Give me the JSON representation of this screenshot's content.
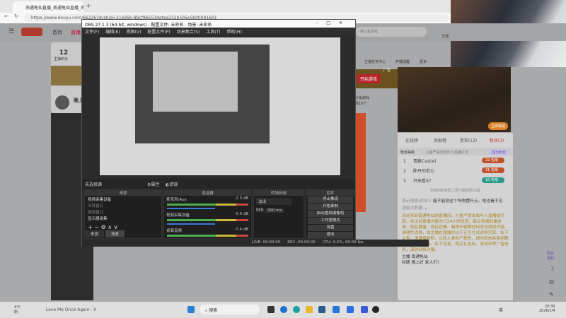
{
  "browser": {
    "tab_title": "南通龟仙直播_南通龟仙直播_南通",
    "url": "https://www.douyu.com/66226?dyshid=21e95b-89cf86553defee232b505e5b00091601"
  },
  "douyu": {
    "nav": [
      "首页",
      "直播"
    ],
    "score": "12",
    "score_label": "主播积分",
    "streamer_name": "晚上",
    "search_placeholder": "搜斗鱼游戏",
    "history": "历史",
    "quick": [
      "主播任务中心",
      "开播提醒",
      "更多"
    ],
    "ad_button": "开始游戏",
    "ad_tag": "广告",
    "ad_play": "立即体验",
    "extra": "斗鱼游戏",
    "extra2": "领10个"
  },
  "obs": {
    "title": "OBS 27.1.3 (64-bit, windows) - 配置文件: 未命名 - 场景: 未命名",
    "menu": [
      "文件(F)",
      "编辑(E)",
      "视图(V)",
      "配置文件(P)",
      "场景集合(S)",
      "工具(T)",
      "帮助(H)"
    ],
    "no_source": "未选择源",
    "props": "属性",
    "filters": "滤镜",
    "docks": {
      "sources": "来源",
      "mixer": "混音器",
      "transitions": "转场特效",
      "controls": "控件"
    },
    "sources": [
      {
        "label": "视频采集设备",
        "active": true
      },
      {
        "label": "节目窗口",
        "active": false
      },
      {
        "label": "游戏窗口",
        "active": false
      },
      {
        "label": "显示器采集",
        "active": true
      }
    ],
    "bottom_tabs": [
      "来源",
      "场景"
    ],
    "mixer": [
      {
        "label": "麦克风/Aux",
        "db": "-2.3 dB"
      },
      {
        "label": "视频采集设备",
        "db": "0.0 dB"
      },
      {
        "label": "桌面音频",
        "db": "-7.4 dB"
      }
    ],
    "transition": "淡出",
    "duration_label": "时长",
    "duration": "300 ms",
    "controls": [
      "停止推流",
      "开始录制",
      "启动虚拟摄像机",
      "工作室模式",
      "设置",
      "退出"
    ],
    "status": {
      "live": "LIVE: 00:00:00",
      "rec": "REC: 00:00:00",
      "cpu": "CPU: 0.5%, 60.00 fps"
    }
  },
  "chat": {
    "tabs": [
      "在线榜",
      "贡献榜",
      "贵宾(12)",
      "粉丝(3)"
    ],
    "fan_level": "粉丝等级",
    "notice": "斗鱼严禁未成年人直播打赏",
    "join": "成为粉丝",
    "ranks": [
      {
        "n": "1",
        "name": "青藤Castiel",
        "lv": "22",
        "badge": "包袱",
        "color": "#c0522a"
      },
      {
        "n": "2",
        "name": "陈丹的老公",
        "lv": "21",
        "badge": "包袱",
        "color": "#c0522a"
      },
      {
        "n": "3",
        "name": "只来看97",
        "lv": "10",
        "badge": "包袱",
        "color": "#2a9a8a"
      }
    ],
    "rank_more": "本房间粉丝团上月已解锁至52级",
    "messages": [
      {
        "user": "表示很感动087:",
        "text": "能不能把这个饰物摆开点，啥也看不见"
      },
      {
        "user": "超级大野猪:",
        "text": "。"
      }
    ],
    "system": "欢迎来到南通龟仙的直播间。斗鱼严禁未成年人直播或打赏。依法对直播内容进行24小时巡查，禁止传播封建迷信、低俗暴露、低俗色情、赌博诈骗等任何违法违规内容。请理性消费，如主播在直播时以不正当方式诱导打赏、私下交易，请谨慎判断，以防人身财产损失。请勿轻信各类招聘征婚、代练代抽、私下交易、购买礼包码、游戏币等广告信息，谨防网络诈骗。",
    "host_label": "主播",
    "host": "南通龟仙",
    "title_label": "标题",
    "title": "晚上好 家人们!",
    "side_label": "粉丝福利"
  },
  "taskbar": {
    "weather": "4°C",
    "weather2": "阴",
    "media": "Love Me Once Again - Ⅱ",
    "search": "搜索",
    "time": "20:30",
    "date": "2026/1/4",
    "lang": "英"
  }
}
